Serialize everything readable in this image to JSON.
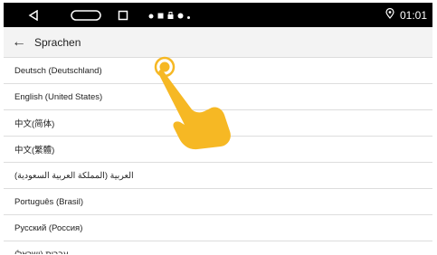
{
  "status_bar": {
    "time": "01:01",
    "icons": [
      "back-triangle-icon",
      "home-pill-icon",
      "recents-square-icon",
      "location-pin-icon",
      "notification-icons"
    ]
  },
  "app_bar": {
    "title": "Sprachen"
  },
  "languages": [
    "Deutsch (Deutschland)",
    "English (United States)",
    "中文(简体)",
    "中文(繁體)",
    "العربية (المملكة العربية السعودية)",
    "Português (Brasil)",
    "Русский (Россия)",
    "עברית (ישראל)"
  ],
  "colors": {
    "status_bar": "#000000",
    "app_bar": "#f3f3f3",
    "tap_hand": "#f6b824"
  }
}
